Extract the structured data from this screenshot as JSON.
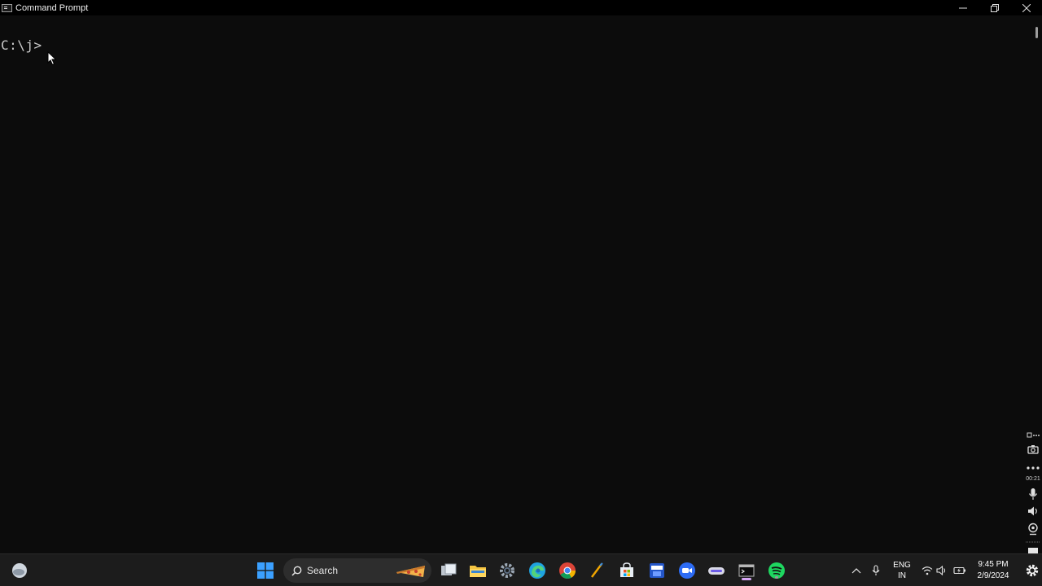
{
  "window": {
    "title": "Command Prompt"
  },
  "console": {
    "prompt": "C:\\j>"
  },
  "recorder": {
    "timer": "00:21"
  },
  "taskbar": {
    "search_label": "Search",
    "pinned": [
      "start-windows-icon",
      "task-view-icon",
      "file-explorer-icon",
      "settings-icon",
      "edge-icon",
      "chrome-icon",
      "pen-app-icon",
      "microsoft-store-icon",
      "dev-home-icon",
      "zoom-icon",
      "keyboard-app-icon",
      "terminal-icon",
      "spotify-icon"
    ],
    "tray": {
      "language_top": "ENG",
      "language_bottom": "IN",
      "time": "9:45 PM",
      "date": "2/9/2024"
    }
  },
  "colors": {
    "console_bg": "#0c0c0c",
    "console_text": "#cccccc",
    "taskbar_bg": "#1c1c1c",
    "accent_active": "#d7a6f4",
    "spotify": "#1ed760",
    "edge": "#1fa3e0",
    "start": "#3ba0ff"
  }
}
